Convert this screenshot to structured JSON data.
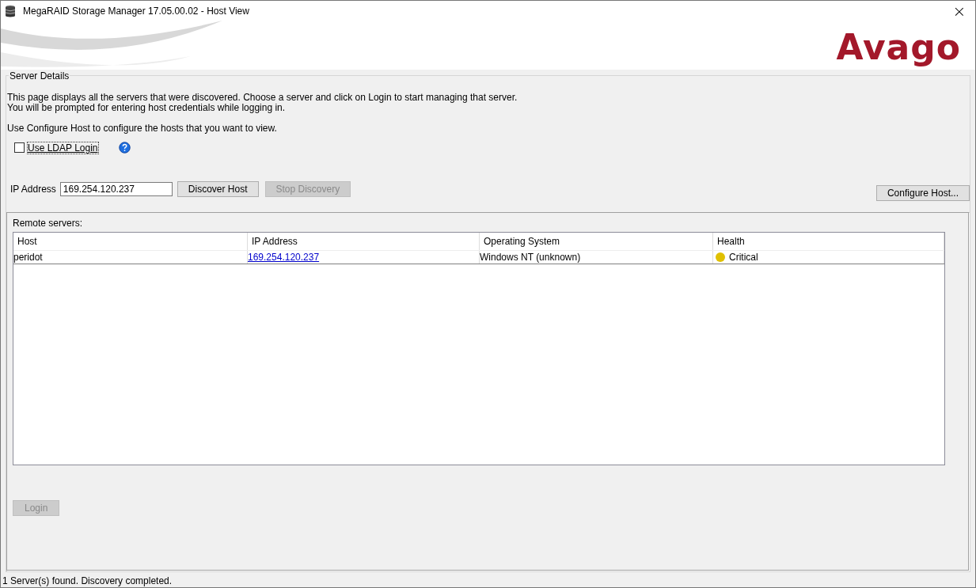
{
  "window": {
    "title": "MegaRAID Storage Manager 17.05.00.02 - Host View",
    "close": "×"
  },
  "logo": "Avago",
  "server_details": {
    "title": "Server Details",
    "intro": [
      "This page displays all the servers that were discovered. Choose a server and click on Login to start managing that server.",
      "You will be prompted for entering host credentials while logging in."
    ],
    "hint": "Use Configure Host to configure the hosts that you want to view.",
    "ldap": {
      "label": "Use LDAP Login",
      "checked": false
    },
    "ip_label": "IP Address",
    "ip_value": "169.254.120.237",
    "buttons": [
      {
        "label": "Discover Host",
        "disabled": false
      },
      {
        "label": "Stop Discovery",
        "disabled": true
      }
    ],
    "configure_button": {
      "label": "Configure Host...",
      "disabled": false
    }
  },
  "remote_servers": {
    "title": "Remote servers:",
    "columns": [
      "Host",
      "IP Address",
      "Operating System",
      "Health"
    ],
    "rows": [
      {
        "host": "peridot",
        "ip": "169.254.120.237",
        "os": "Windows NT (unknown)",
        "health": "Critical",
        "color": "#e0c000"
      }
    ]
  },
  "login_button": {
    "label": "Login",
    "disabled": true
  },
  "status_bar": "1 Server(s) found. Discovery completed."
}
